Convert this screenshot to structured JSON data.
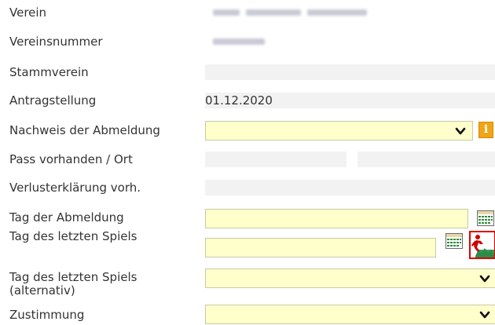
{
  "form": {
    "rows": [
      {
        "label": "Verein"
      },
      {
        "label": "Vereinsnummer"
      },
      {
        "label": "Stammverein"
      },
      {
        "label": "Antragstellung",
        "value": "01.12.2020"
      },
      {
        "label": "Nachweis der Abmeldung",
        "selected": ""
      },
      {
        "label": "Pass vorhanden / Ort"
      },
      {
        "label": "Verlusterklärung vorh."
      },
      {
        "label": "Tag der Abmeldung",
        "value": ""
      },
      {
        "label": "Tag des letzten Spiels",
        "value": ""
      },
      {
        "label": "Tag des letzten Spiels\n(alternativ)",
        "selected": ""
      },
      {
        "label": "Zustimmung",
        "selected": ""
      }
    ],
    "info_icon_glyph": "i"
  },
  "colors": {
    "field_yellow": "#ffffcc",
    "field_grey": "#f2f2f2",
    "info_orange": "#f0a418",
    "highlight_red": "#e00000"
  }
}
